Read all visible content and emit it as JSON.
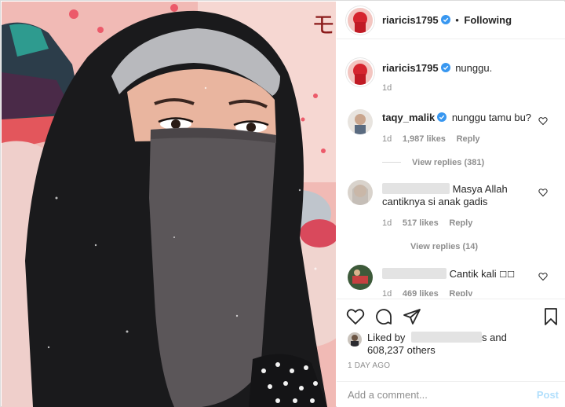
{
  "header": {
    "username": "riaricis1795",
    "separator": "•",
    "follow_status": "Following"
  },
  "caption": {
    "username": "riaricis1795",
    "text": "nunggu.",
    "time": "1d"
  },
  "comments": [
    {
      "username": "taqy_malik",
      "text": "nunggu tamu bu?",
      "time": "1d",
      "likes": "1,987 likes",
      "reply_label": "Reply",
      "view_replies": "View replies (381)"
    },
    {
      "username": "",
      "text_line1": "Masya Allah",
      "text_line2": "cantiknya si anak gadis",
      "time": "1d",
      "likes": "517 likes",
      "reply_label": "Reply",
      "view_replies": "View replies (14)"
    },
    {
      "username": "",
      "text": "Cantik kali",
      "trailing_glyphs": "☐☐",
      "time": "1d",
      "likes": "469 likes",
      "reply_label": "Reply"
    }
  ],
  "likes": {
    "prefix": "Liked by",
    "suffix": "s and",
    "count_line": "608,237 others"
  },
  "post_date": "1 DAY AGO",
  "comment_box": {
    "placeholder": "Add a comment...",
    "post_label": "Post"
  },
  "colors": {
    "verified": "#3897f0",
    "post_disabled": "#b2dffc",
    "muted": "#8e8e8e"
  },
  "icons": [
    "heart-icon",
    "comment-icon",
    "share-icon",
    "bookmark-icon",
    "verified-badge-icon"
  ]
}
